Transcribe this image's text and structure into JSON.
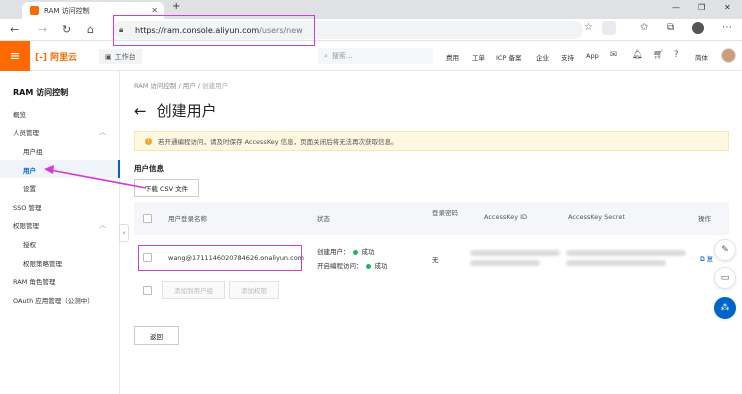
{
  "browser": {
    "tab_title": "RAM 访问控制",
    "url_host": "https://ram.console.aliyun.com",
    "url_path": "/users/new"
  },
  "header": {
    "logo": "[-] 阿里云",
    "workbench": "工作台",
    "search_placeholder": "搜索...",
    "links": [
      "费用",
      "工单",
      "ICP 备案",
      "企业",
      "支持",
      "App"
    ],
    "lang": "简体"
  },
  "sidebar": {
    "title": "RAM 访问控制",
    "items": [
      {
        "label": "概览"
      },
      {
        "label": "人员管理"
      },
      {
        "label": "用户组"
      },
      {
        "label": "用户"
      },
      {
        "label": "设置"
      },
      {
        "label": "SSO 管理"
      },
      {
        "label": "权限管理"
      },
      {
        "label": "授权"
      },
      {
        "label": "权限策略管理"
      },
      {
        "label": "RAM 角色管理"
      },
      {
        "label": "OAuth 应用管理（公测中）"
      }
    ]
  },
  "main": {
    "breadcrumb": [
      "RAM 访问控制",
      "用户",
      "创建用户"
    ],
    "page_title": "创建用户",
    "notice": "若开通编程访问，请及时保存 AccessKey 信息，页面关闭后将无法再次获取信息。",
    "section_title": "用户信息",
    "download_csv": "下载 CSV 文件",
    "table": {
      "headers": [
        "用户登录名称",
        "状态",
        "登录密码",
        "AccessKey ID",
        "AccessKey Secret",
        "操作"
      ],
      "rows": [
        {
          "login_name": "wang@1711146020784626.onaliyun.com",
          "status_create": "创建用户：",
          "status_create_val": "成功",
          "status_prog": "开启编程访问：",
          "status_prog_val": "成功",
          "password": "无"
        }
      ],
      "add_user_btn": "添加到用户组",
      "add_perm_btn": "添加权限"
    },
    "back_btn": "返回"
  },
  "colors": {
    "brand": "#ff6a00",
    "primary": "#0064c8",
    "highlight": "#d43ad8",
    "success": "#1fb65a"
  }
}
